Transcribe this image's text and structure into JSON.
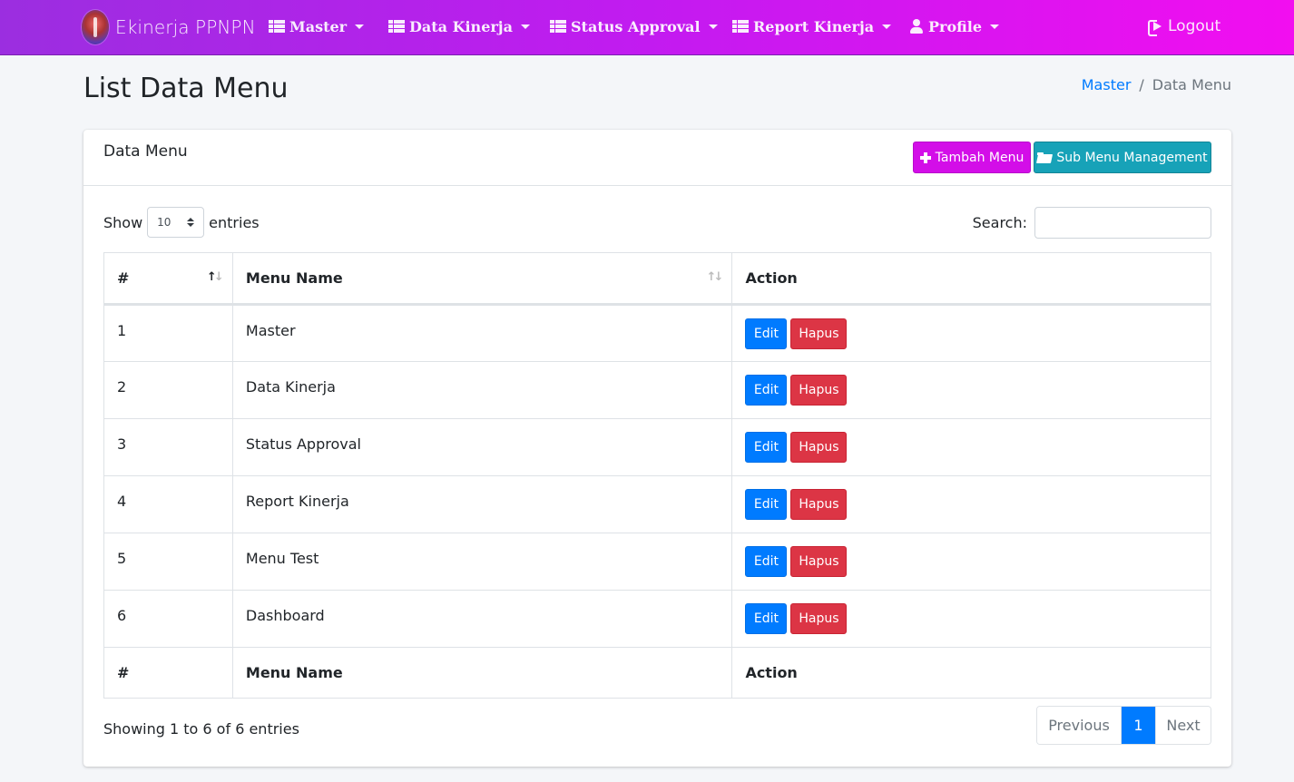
{
  "navbar": {
    "brand": "Ekinerja PPNPN",
    "items": [
      {
        "label": "Master"
      },
      {
        "label": "Data Kinerja"
      },
      {
        "label": "Status Approval"
      },
      {
        "label": "Report Kinerja"
      },
      {
        "label": "Profile"
      }
    ],
    "logout": "Logout",
    "gradient": [
      "#9b2ee0",
      "#f20ef0"
    ]
  },
  "header": {
    "title": "List Data Menu",
    "breadcrumb": {
      "link": "Master",
      "separator": "/",
      "current": "Data Menu"
    }
  },
  "card": {
    "title": "Data Menu",
    "tambah_label": "Tambah Menu",
    "sub_label": "Sub Menu Management"
  },
  "controls": {
    "show": "Show",
    "length_value": "10",
    "entries": "entries",
    "search_label": "Search:",
    "search_value": ""
  },
  "table": {
    "columns": [
      "#",
      "Menu Name",
      "Action"
    ],
    "rows": [
      {
        "no": "1",
        "name": "Master"
      },
      {
        "no": "2",
        "name": "Data Kinerja"
      },
      {
        "no": "3",
        "name": "Status Approval"
      },
      {
        "no": "4",
        "name": "Report Kinerja"
      },
      {
        "no": "5",
        "name": "Menu Test"
      },
      {
        "no": "6",
        "name": "Dashboard"
      }
    ],
    "edit_label": "Edit",
    "hapus_label": "Hapus"
  },
  "footer": {
    "info": "Showing 1 to 6 of 6 entries",
    "prev": "Previous",
    "page": "1",
    "next": "Next"
  },
  "colors": {
    "accent": "#d30ee8",
    "info": "#17a2b8",
    "primary": "#007bff",
    "danger": "#dc3545"
  }
}
